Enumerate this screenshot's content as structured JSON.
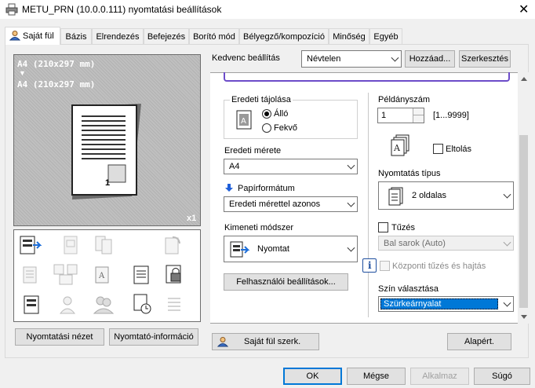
{
  "window": {
    "title": "METU_PRN (10.0.0.111) nyomtatási beállítások"
  },
  "tabs": [
    {
      "label": "Saját fül"
    },
    {
      "label": "Bázis"
    },
    {
      "label": "Elrendezés"
    },
    {
      "label": "Befejezés"
    },
    {
      "label": "Borító mód"
    },
    {
      "label": "Bélyegző/kompozíció"
    },
    {
      "label": "Minőség"
    },
    {
      "label": "Egyéb"
    }
  ],
  "preview": {
    "line1": "A4 (210x297 mm)",
    "arrow": "▼",
    "line2": "A4 (210x297 mm)",
    "copies_badge": "x1",
    "page_number": "1"
  },
  "left_buttons": {
    "print_view": "Nyomtatási nézet",
    "printer_info": "Nyomtató-információ"
  },
  "favorites": {
    "label": "Kedvenc beállítás",
    "value": "Névtelen",
    "add": "Hozzáad...",
    "edit": "Szerkesztés"
  },
  "orientation": {
    "group": "Eredeti tájolása",
    "portrait": "Álló",
    "landscape": "Fekvő"
  },
  "original_size": {
    "label": "Eredeti mérete",
    "value": "A4"
  },
  "paper_format": {
    "label": "Papírformátum",
    "value": "Eredeti mérettel azonos"
  },
  "output_method": {
    "label": "Kimeneti módszer",
    "value": "Nyomtat"
  },
  "user_settings_button": "Felhasználói beállítások...",
  "copies": {
    "label": "Példányszám",
    "value": "1",
    "range": "[1...9999]"
  },
  "collate": {
    "label": "Eltolás"
  },
  "print_type": {
    "label": "Nyomtatás típus",
    "value": "2 oldalas"
  },
  "staple": {
    "label": "Tűzés",
    "value": "Bal sarok (Auto)"
  },
  "center_staple": {
    "label": "Központi tűzés és hajtás"
  },
  "info_icon_glyph": "i",
  "color": {
    "label": "Szín választása",
    "value": "Szürkeárnyalat"
  },
  "bottom": {
    "custom_tab": "Saját fül szerk.",
    "default": "Alapért."
  },
  "dialog": {
    "ok": "OK",
    "cancel": "Mégse",
    "apply": "Alkalmaz",
    "help": "Súgó"
  },
  "close_glyph": "✕"
}
